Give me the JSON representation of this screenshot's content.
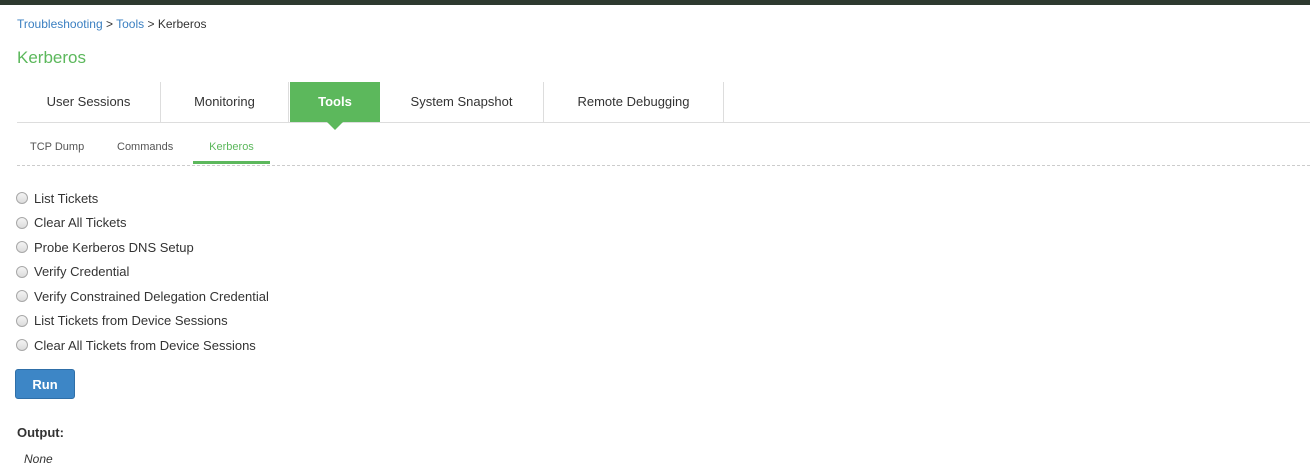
{
  "breadcrumb": {
    "items": [
      "Troubleshooting",
      "Tools",
      "Kerberos"
    ],
    "separator": ">"
  },
  "page_title": "Kerberos",
  "main_tabs": [
    {
      "label": "User Sessions",
      "active": false
    },
    {
      "label": "Monitoring",
      "active": false
    },
    {
      "label": "Tools",
      "active": true
    },
    {
      "label": "System Snapshot",
      "active": false
    },
    {
      "label": "Remote Debugging",
      "active": false
    }
  ],
  "sub_tabs": [
    {
      "label": "TCP Dump",
      "active": false
    },
    {
      "label": "Commands",
      "active": false
    },
    {
      "label": "Kerberos",
      "active": true
    }
  ],
  "options": [
    {
      "label": "List Tickets",
      "selected": false
    },
    {
      "label": "Clear All Tickets",
      "selected": false
    },
    {
      "label": "Probe Kerberos DNS Setup",
      "selected": false
    },
    {
      "label": "Verify Credential",
      "selected": false
    },
    {
      "label": "Verify Constrained Delegation Credential",
      "selected": false
    },
    {
      "label": "List Tickets from Device Sessions",
      "selected": false
    },
    {
      "label": "Clear All Tickets from Device Sessions",
      "selected": false
    }
  ],
  "run_button_label": "Run",
  "output": {
    "label": "Output:",
    "value": "None"
  },
  "colors": {
    "accent_green": "#5cb85c",
    "link_blue": "#3a7fc1",
    "button_blue": "#3d86c6"
  }
}
